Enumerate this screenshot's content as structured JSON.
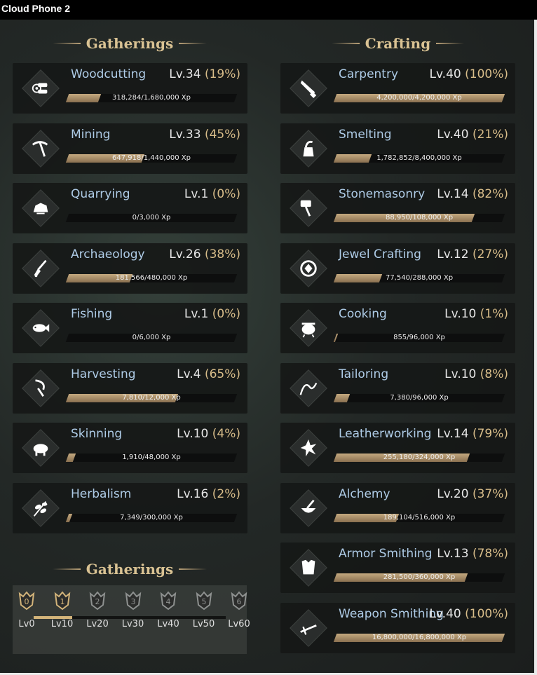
{
  "window": {
    "title": "Cloud Phone 2"
  },
  "headers": {
    "gatherings": "Gatherings",
    "crafting": "Crafting",
    "gatherings_bonus": "Gatherings"
  },
  "gathering": [
    {
      "name": "Woodcutting",
      "level": "Lv.34",
      "percent": "(19%)",
      "xp": "318,284/1,680,000 Xp",
      "progress": 0.19,
      "icon": "logs-icon"
    },
    {
      "name": "Mining",
      "level": "Lv.33",
      "percent": "(45%)",
      "xp": "647,918/1,440,000 Xp",
      "progress": 0.45,
      "icon": "pickaxe-icon"
    },
    {
      "name": "Quarrying",
      "level": "Lv.1",
      "percent": "(0%)",
      "xp": "0/3,000 Xp",
      "progress": 0.0,
      "icon": "stone-icon"
    },
    {
      "name": "Archaeology",
      "level": "Lv.26",
      "percent": "(38%)",
      "xp": "181,566/480,000 Xp",
      "progress": 0.38,
      "icon": "shovel-icon"
    },
    {
      "name": "Fishing",
      "level": "Lv.1",
      "percent": "(0%)",
      "xp": "0/6,000 Xp",
      "progress": 0.0,
      "icon": "fish-icon"
    },
    {
      "name": "Harvesting",
      "level": "Lv.4",
      "percent": "(65%)",
      "xp": "7,810/12,000 Xp",
      "progress": 0.65,
      "icon": "sickle-icon"
    },
    {
      "name": "Skinning",
      "level": "Lv.10",
      "percent": "(4%)",
      "xp": "1,910/48,000 Xp",
      "progress": 0.04,
      "icon": "boar-icon"
    },
    {
      "name": "Herbalism",
      "level": "Lv.16",
      "percent": "(2%)",
      "xp": "7,349/300,000 Xp",
      "progress": 0.02,
      "icon": "herb-icon"
    }
  ],
  "crafting": [
    {
      "name": "Carpentry",
      "level": "Lv.40",
      "percent": "(100%)",
      "xp": "4,200,000/4,200,000 Xp",
      "progress": 1.0,
      "icon": "saw-icon"
    },
    {
      "name": "Smelting",
      "level": "Lv.40",
      "percent": "(21%)",
      "xp": "1,782,852/8,400,000 Xp",
      "progress": 0.21,
      "icon": "furnace-icon"
    },
    {
      "name": "Stonemasonry",
      "level": "Lv.14",
      "percent": "(82%)",
      "xp": "88,950/108,000 Xp",
      "progress": 0.82,
      "icon": "hammer-icon"
    },
    {
      "name": "Jewel Crafting",
      "level": "Lv.12",
      "percent": "(27%)",
      "xp": "77,540/288,000 Xp",
      "progress": 0.27,
      "icon": "gem-icon"
    },
    {
      "name": "Cooking",
      "level": "Lv.10",
      "percent": "(1%)",
      "xp": "855/96,000 Xp",
      "progress": 0.01,
      "icon": "pot-icon"
    },
    {
      "name": "Tailoring",
      "level": "Lv.10",
      "percent": "(8%)",
      "xp": "7,380/96,000 Xp",
      "progress": 0.08,
      "icon": "needle-icon"
    },
    {
      "name": "Leatherworking",
      "level": "Lv.14",
      "percent": "(79%)",
      "xp": "255,180/324,000 Xp",
      "progress": 0.79,
      "icon": "hide-icon"
    },
    {
      "name": "Alchemy",
      "level": "Lv.20",
      "percent": "(37%)",
      "xp": "189,104/516,000 Xp",
      "progress": 0.37,
      "icon": "mortar-icon"
    },
    {
      "name": "Armor Smithing",
      "level": "Lv.13",
      "percent": "(78%)",
      "xp": "281,500/360,000 Xp",
      "progress": 0.78,
      "icon": "armor-icon"
    },
    {
      "name": "Weapon Smithing",
      "level": "Lv.40",
      "percent": "(100%)",
      "xp": "16,800,000/16,800,000 Xp",
      "progress": 1.0,
      "icon": "sword-icon"
    }
  ],
  "bonus_tiers": {
    "progress": 0.2,
    "tiers": [
      {
        "badge": "0",
        "label": "Lv0",
        "active": true
      },
      {
        "badge": "1",
        "label": "Lv10",
        "active": true
      },
      {
        "badge": "2",
        "label": "Lv20",
        "active": false
      },
      {
        "badge": "3",
        "label": "Lv30",
        "active": false
      },
      {
        "badge": "4",
        "label": "Lv40",
        "active": false
      },
      {
        "badge": "5",
        "label": "Lv50",
        "active": false
      },
      {
        "badge": "6",
        "label": "Lv60",
        "active": false
      }
    ]
  },
  "colors": {
    "skill_name": "#aecbe6",
    "percent": "#d8bd8a",
    "header": "#d9c293",
    "bar_fill": "#b89c72",
    "tier_active": "#d3b47a",
    "tier_inactive": "#8e9190"
  }
}
